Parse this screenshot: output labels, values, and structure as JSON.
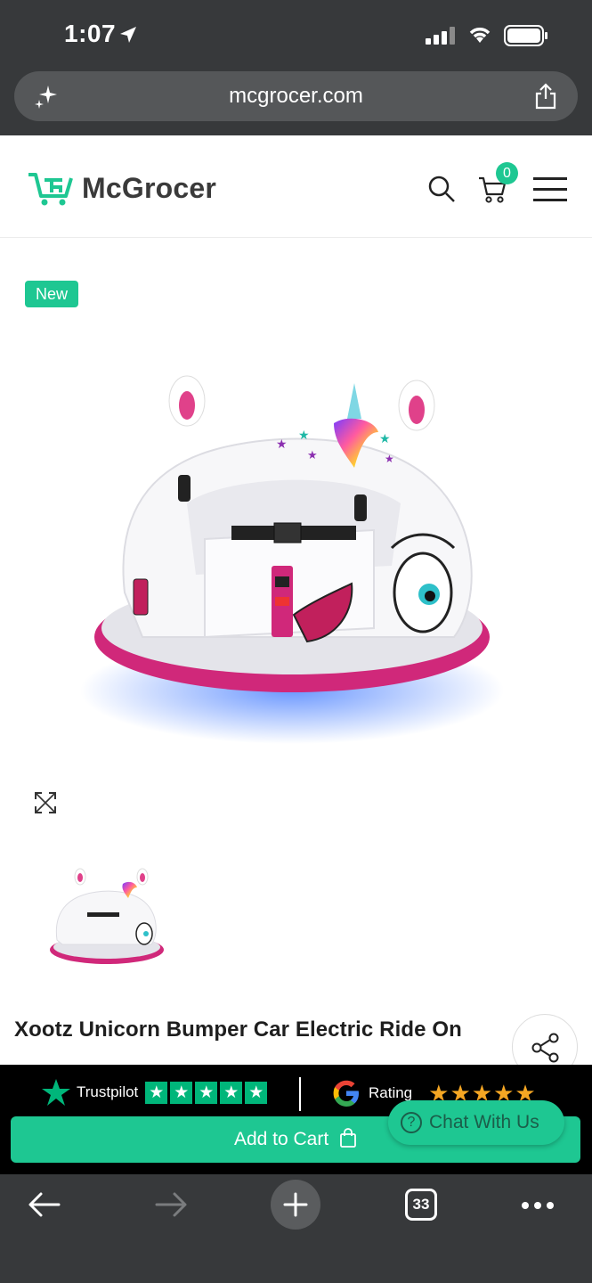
{
  "status_bar": {
    "time": "1:07"
  },
  "browser": {
    "url": "mcgrocer.com",
    "tab_count": "33"
  },
  "header": {
    "logo_text": "McGrocer",
    "cart_count": "0"
  },
  "product": {
    "badge": "New",
    "title": "Xootz Unicorn Bumper Car Electric Ride On"
  },
  "ratings": {
    "trustpilot_label": "Trustpilot",
    "trustpilot_stars": 5,
    "google_label": "Rating",
    "google_stars": "★★★★★"
  },
  "actions": {
    "add_to_cart": "Add to Cart",
    "chat": "Chat With Us"
  },
  "colors": {
    "accent": "#1ec792",
    "browser_chrome": "#37393b",
    "pink": "#d0287a"
  }
}
